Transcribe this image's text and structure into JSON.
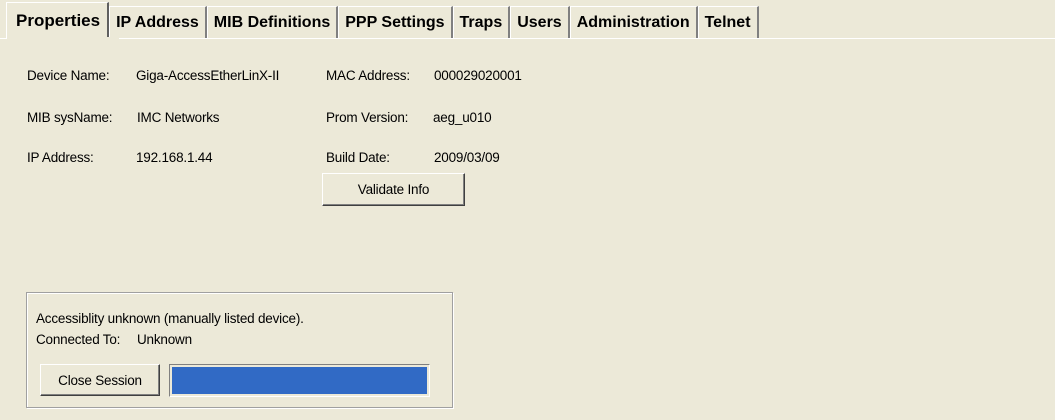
{
  "tabs": [
    {
      "id": "properties",
      "label": "Properties",
      "active": true
    },
    {
      "id": "ip-address",
      "label": "IP Address",
      "active": false
    },
    {
      "id": "mib-definitions",
      "label": "MIB Definitions",
      "active": false
    },
    {
      "id": "ppp-settings",
      "label": "PPP Settings",
      "active": false
    },
    {
      "id": "traps",
      "label": "Traps",
      "active": false
    },
    {
      "id": "users",
      "label": "Users",
      "active": false
    },
    {
      "id": "administration",
      "label": "Administration",
      "active": false
    },
    {
      "id": "telnet",
      "label": "Telnet",
      "active": false
    }
  ],
  "properties": {
    "device_name_label": "Device Name:",
    "device_name_value": "Giga-AccessEtherLinX-II",
    "mac_address_label": "MAC Address:",
    "mac_address_value": "000029020001",
    "mib_sysname_label": "MIB sysName:",
    "mib_sysname_value": "IMC Networks",
    "prom_version_label": "Prom Version:",
    "prom_version_value": "aeg_u010",
    "ip_address_label": "IP Address:",
    "ip_address_value": "192.168.1.44",
    "build_date_label": "Build Date:",
    "build_date_value": "2009/03/09",
    "validate_button": "Validate Info"
  },
  "status": {
    "accessibility_text": "Accessiblity unknown (manually listed device).",
    "connected_to_label": "Connected To:",
    "connected_to_value": "Unknown",
    "close_session_button": "Close Session",
    "progress_fraction": 1.0
  },
  "colors": {
    "window_background": "#ece9d8",
    "progress_fill": "#316ac5"
  }
}
